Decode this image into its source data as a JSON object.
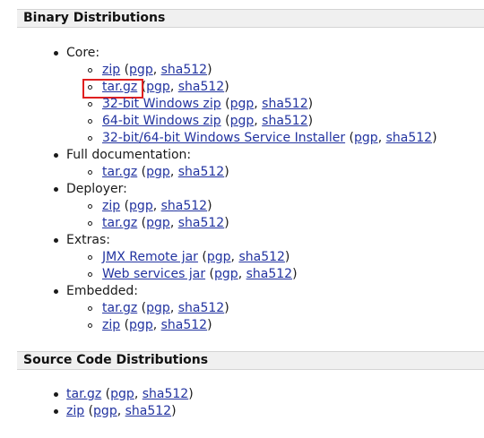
{
  "sections": {
    "binary_title": "Binary Distributions",
    "source_title": "Source Code Distributions"
  },
  "binary": {
    "core": {
      "label": "Core:",
      "items": [
        {
          "name": "zip",
          "pgp": "pgp",
          "sha": "sha512"
        },
        {
          "name": "tar.gz",
          "pgp": "pgp",
          "sha": "sha512"
        },
        {
          "name": "32-bit Windows zip",
          "pgp": "pgp",
          "sha": "sha512"
        },
        {
          "name": "64-bit Windows zip",
          "pgp": "pgp",
          "sha": "sha512"
        },
        {
          "name": "32-bit/64-bit Windows Service Installer",
          "pgp": "pgp",
          "sha": "sha512"
        }
      ]
    },
    "docs": {
      "label": "Full documentation:",
      "items": [
        {
          "name": "tar.gz",
          "pgp": "pgp",
          "sha": "sha512"
        }
      ]
    },
    "deployer": {
      "label": "Deployer:",
      "items": [
        {
          "name": "zip",
          "pgp": "pgp",
          "sha": "sha512"
        },
        {
          "name": "tar.gz",
          "pgp": "pgp",
          "sha": "sha512"
        }
      ]
    },
    "extras": {
      "label": "Extras:",
      "items": [
        {
          "name": "JMX Remote jar",
          "pgp": "pgp",
          "sha": "sha512"
        },
        {
          "name": "Web services jar",
          "pgp": "pgp",
          "sha": "sha512"
        }
      ]
    },
    "embedded": {
      "label": "Embedded:",
      "items": [
        {
          "name": "tar.gz",
          "pgp": "pgp",
          "sha": "sha512"
        },
        {
          "name": "zip",
          "pgp": "pgp",
          "sha": "sha512"
        }
      ]
    }
  },
  "source": {
    "items": [
      {
        "name": "tar.gz",
        "pgp": "pgp",
        "sha": "sha512"
      },
      {
        "name": "zip",
        "pgp": "pgp",
        "sha": "sha512"
      }
    ]
  },
  "punct": {
    "open": " (",
    "comma": ", ",
    "close": ")"
  },
  "colors": {
    "link": "#2233a0",
    "highlight": "#e02020",
    "header_bg": "#f0f0f0"
  }
}
